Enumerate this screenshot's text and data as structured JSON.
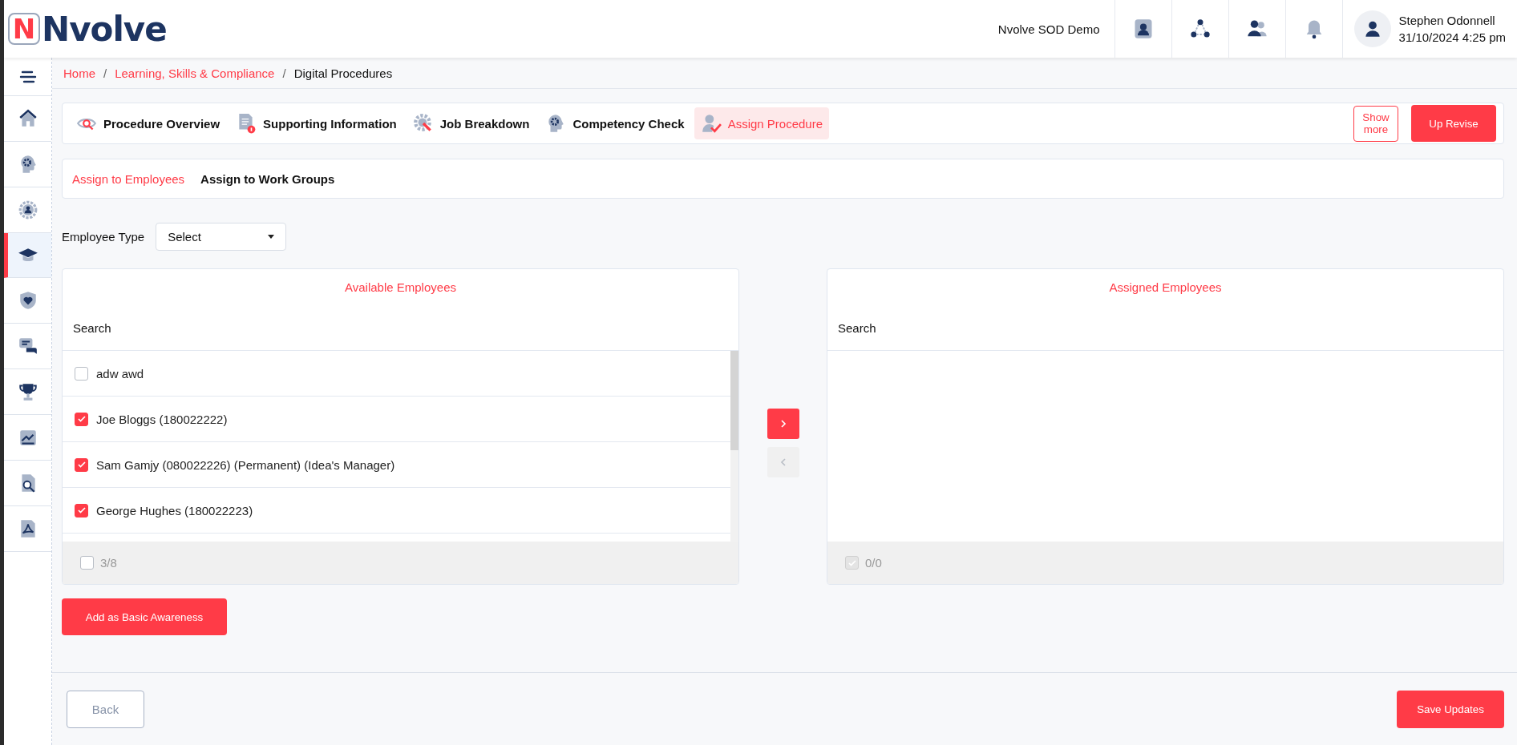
{
  "header": {
    "logo_letter": "N",
    "logo_text": "Nvolve",
    "org": "Nvolve SOD Demo",
    "user_name": "Stephen Odonnell",
    "datetime": "31/10/2024 4:25 pm"
  },
  "sidebar": {
    "items": [
      {
        "kind": "home",
        "selected": false
      },
      {
        "kind": "head-gear",
        "selected": false
      },
      {
        "kind": "gear-person",
        "selected": false
      },
      {
        "kind": "graduation",
        "selected": true
      },
      {
        "kind": "shield-heart",
        "selected": false
      },
      {
        "kind": "chat",
        "selected": false
      },
      {
        "kind": "trophy",
        "selected": false
      },
      {
        "kind": "chart",
        "selected": false
      },
      {
        "kind": "doc-search",
        "selected": false
      },
      {
        "kind": "pdf",
        "selected": false
      }
    ]
  },
  "breadcrumb": [
    {
      "label": "Home",
      "link": true
    },
    {
      "separator": "/",
      "label": "Learning, Skills & Compliance",
      "link": true
    },
    {
      "separator": "/",
      "label": "Digital Procedures",
      "link": false
    }
  ],
  "tabs": [
    {
      "label": "Procedure Overview",
      "kind": "eye",
      "selected": false
    },
    {
      "label": "Supporting Information",
      "kind": "doc-info",
      "selected": false
    },
    {
      "label": "Job Breakdown",
      "kind": "gear-wrench",
      "selected": false
    },
    {
      "label": "Competency Check",
      "kind": "head-gear",
      "selected": false
    },
    {
      "label": "Assign Procedure",
      "kind": "person-check",
      "selected": true
    }
  ],
  "show_more": "Show more",
  "up_revise": "Up Revise",
  "subtabs": [
    {
      "label": "Assign to Employees",
      "selected": true
    },
    {
      "label": "Assign to Work Groups",
      "selected": false
    }
  ],
  "employee_type": {
    "label": "Employee Type",
    "value": "Select"
  },
  "available": {
    "title": "Available Employees",
    "search_label": "Search",
    "items": [
      {
        "name": "adw awd",
        "checked": false
      },
      {
        "name": "Joe Bloggs (180022222)",
        "checked": true
      },
      {
        "name": "Sam Gamjy (080022226) (Permanent) (Idea's Manager)",
        "checked": true
      },
      {
        "name": "George Hughes (180022223)",
        "checked": true
      }
    ],
    "count": "3/8",
    "all_checked": false,
    "disabled": false
  },
  "move_buttons": [
    {
      "kind": "right",
      "disabled": false
    },
    {
      "kind": "left",
      "disabled": true
    }
  ],
  "assigned": {
    "title": "Assigned Employees",
    "search_label": "Search",
    "count": "0/0",
    "all_checked": true,
    "disabled": true
  },
  "add_button": "Add as Basic Awareness",
  "back_button": "Back",
  "save_button": "Save Updates"
}
